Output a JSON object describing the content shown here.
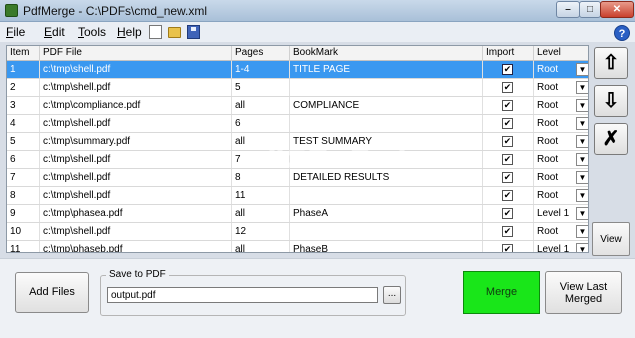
{
  "window": {
    "title": "PdfMerge - C:\\PDFs\\cmd_new.xml",
    "minimize_glyph": "–",
    "maximize_glyph": "□",
    "close_glyph": "✕"
  },
  "menu": [
    {
      "label": "File"
    },
    {
      "label": "Edit"
    },
    {
      "label": "Tools"
    },
    {
      "label": "Help"
    }
  ],
  "toolbar_icons": [
    "new-file-icon",
    "open-folder-icon",
    "save-disk-icon"
  ],
  "help_glyph": "?",
  "grid": {
    "headers": {
      "item": "Item",
      "file": "PDF File",
      "pages": "Pages",
      "bookmark": "BookMark",
      "import": "Import",
      "level": "Level"
    },
    "rows": [
      {
        "item": "1",
        "file": "c:\\tmp\\shell.pdf",
        "pages": "1-4",
        "bookmark": "TITLE PAGE",
        "import": "✔",
        "level": "Root",
        "selected": true
      },
      {
        "item": "2",
        "file": "c:\\tmp\\shell.pdf",
        "pages": "5",
        "bookmark": "",
        "import": "✔",
        "level": "Root"
      },
      {
        "item": "3",
        "file": "c:\\tmp\\compliance.pdf",
        "pages": "all",
        "bookmark": "COMPLIANCE",
        "import": "✔",
        "level": "Root"
      },
      {
        "item": "4",
        "file": "c:\\tmp\\shell.pdf",
        "pages": "6",
        "bookmark": "",
        "import": "✔",
        "level": "Root"
      },
      {
        "item": "5",
        "file": "c:\\tmp\\summary.pdf",
        "pages": "all",
        "bookmark": "TEST SUMMARY",
        "import": "✔",
        "level": "Root"
      },
      {
        "item": "6",
        "file": "c:\\tmp\\shell.pdf",
        "pages": "7",
        "bookmark": "",
        "import": "✔",
        "level": "Root"
      },
      {
        "item": "7",
        "file": "c:\\tmp\\shell.pdf",
        "pages": "8",
        "bookmark": "DETAILED RESULTS",
        "import": "✔",
        "level": "Root"
      },
      {
        "item": "8",
        "file": "c:\\tmp\\shell.pdf",
        "pages": "11",
        "bookmark": "",
        "import": "✔",
        "level": "Root"
      },
      {
        "item": "9",
        "file": "c:\\tmp\\phasea.pdf",
        "pages": "all",
        "bookmark": "PhaseA",
        "import": "✔",
        "level": "Level 1"
      },
      {
        "item": "10",
        "file": "c:\\tmp\\shell.pdf",
        "pages": "12",
        "bookmark": "",
        "import": "✔",
        "level": "Root"
      },
      {
        "item": "11",
        "file": "c:\\tmp\\phaseb.pdf",
        "pages": "all",
        "bookmark": "PhaseB",
        "import": "✔",
        "level": "Level 1"
      }
    ],
    "dropdown_glyph": "▼"
  },
  "side_buttons": {
    "up_glyph": "⇧",
    "down_glyph": "⇩",
    "delete_glyph": "✗",
    "view_label": "View"
  },
  "bottom": {
    "add_files_label": "Add Files",
    "save_legend": "Save to PDF",
    "save_value": "output.pdf",
    "browse_label": "...",
    "merge_label": "Merge",
    "view_last_merged_label": "View Last Merged"
  },
  "colors": {
    "selection": "#3a98f0",
    "merge_button": "#19e619"
  }
}
